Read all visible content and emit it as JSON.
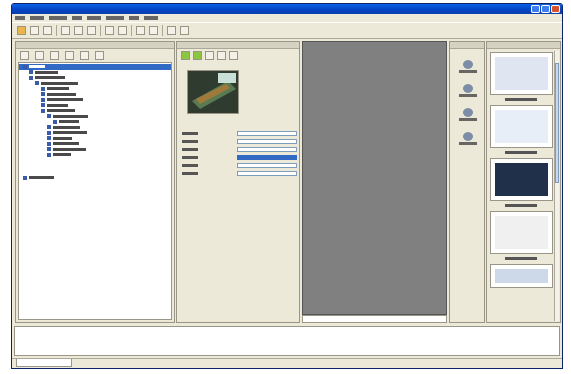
{
  "window": {
    "title": ""
  },
  "menu": [
    "",
    "",
    "",
    "",
    "",
    "",
    "",
    ""
  ],
  "toolbar": {
    "buttons": [
      {
        "name": "new-icon"
      },
      {
        "name": "open-icon"
      },
      {
        "name": "save-icon"
      },
      {
        "name": "cut-icon"
      },
      {
        "name": "copy-icon"
      },
      {
        "name": "paste-icon"
      },
      {
        "name": "undo-icon"
      },
      {
        "name": "redo-icon"
      },
      {
        "name": "run-icon"
      },
      {
        "name": "stop-icon"
      },
      {
        "name": "zoom-in-icon"
      },
      {
        "name": "zoom-out-icon"
      }
    ]
  },
  "explorer": {
    "header": "",
    "nodes": [
      {
        "depth": 0,
        "label": ""
      },
      {
        "depth": 1,
        "label": ""
      },
      {
        "depth": 1,
        "label": ""
      },
      {
        "depth": 2,
        "label": ""
      },
      {
        "depth": 3,
        "label": ""
      },
      {
        "depth": 3,
        "label": ""
      },
      {
        "depth": 3,
        "label": ""
      },
      {
        "depth": 3,
        "label": ""
      },
      {
        "depth": 3,
        "label": ""
      },
      {
        "depth": 4,
        "label": ""
      },
      {
        "depth": 5,
        "label": ""
      },
      {
        "depth": 4,
        "label": ""
      },
      {
        "depth": 4,
        "label": ""
      },
      {
        "depth": 4,
        "label": ""
      },
      {
        "depth": 4,
        "label": ""
      },
      {
        "depth": 4,
        "label": ""
      },
      {
        "depth": 4,
        "label": ""
      },
      {
        "depth": 0,
        "label": ""
      }
    ]
  },
  "properties": {
    "header": "",
    "rows": [
      {
        "label": "",
        "value": ""
      },
      {
        "label": "",
        "value": ""
      },
      {
        "label": "",
        "value": ""
      },
      {
        "label": "",
        "value": ""
      },
      {
        "label": "",
        "value": ""
      },
      {
        "label": "",
        "value": ""
      }
    ]
  },
  "tools": {
    "header": "",
    "items": [
      {
        "icon": "shape-icon",
        "label": ""
      },
      {
        "icon": "layer-icon",
        "label": ""
      },
      {
        "icon": "filter-icon",
        "label": ""
      },
      {
        "icon": "export-icon",
        "label": ""
      }
    ]
  },
  "preview": {
    "header": "",
    "tiles": [
      {
        "label": ""
      },
      {
        "label": ""
      },
      {
        "label": ""
      },
      {
        "label": ""
      },
      {
        "label": ""
      }
    ]
  },
  "status": {
    "tab_label": ""
  },
  "colors": {
    "titlebar": "#0a62e6",
    "canvas": "#808080",
    "selection": "#316ac5"
  }
}
